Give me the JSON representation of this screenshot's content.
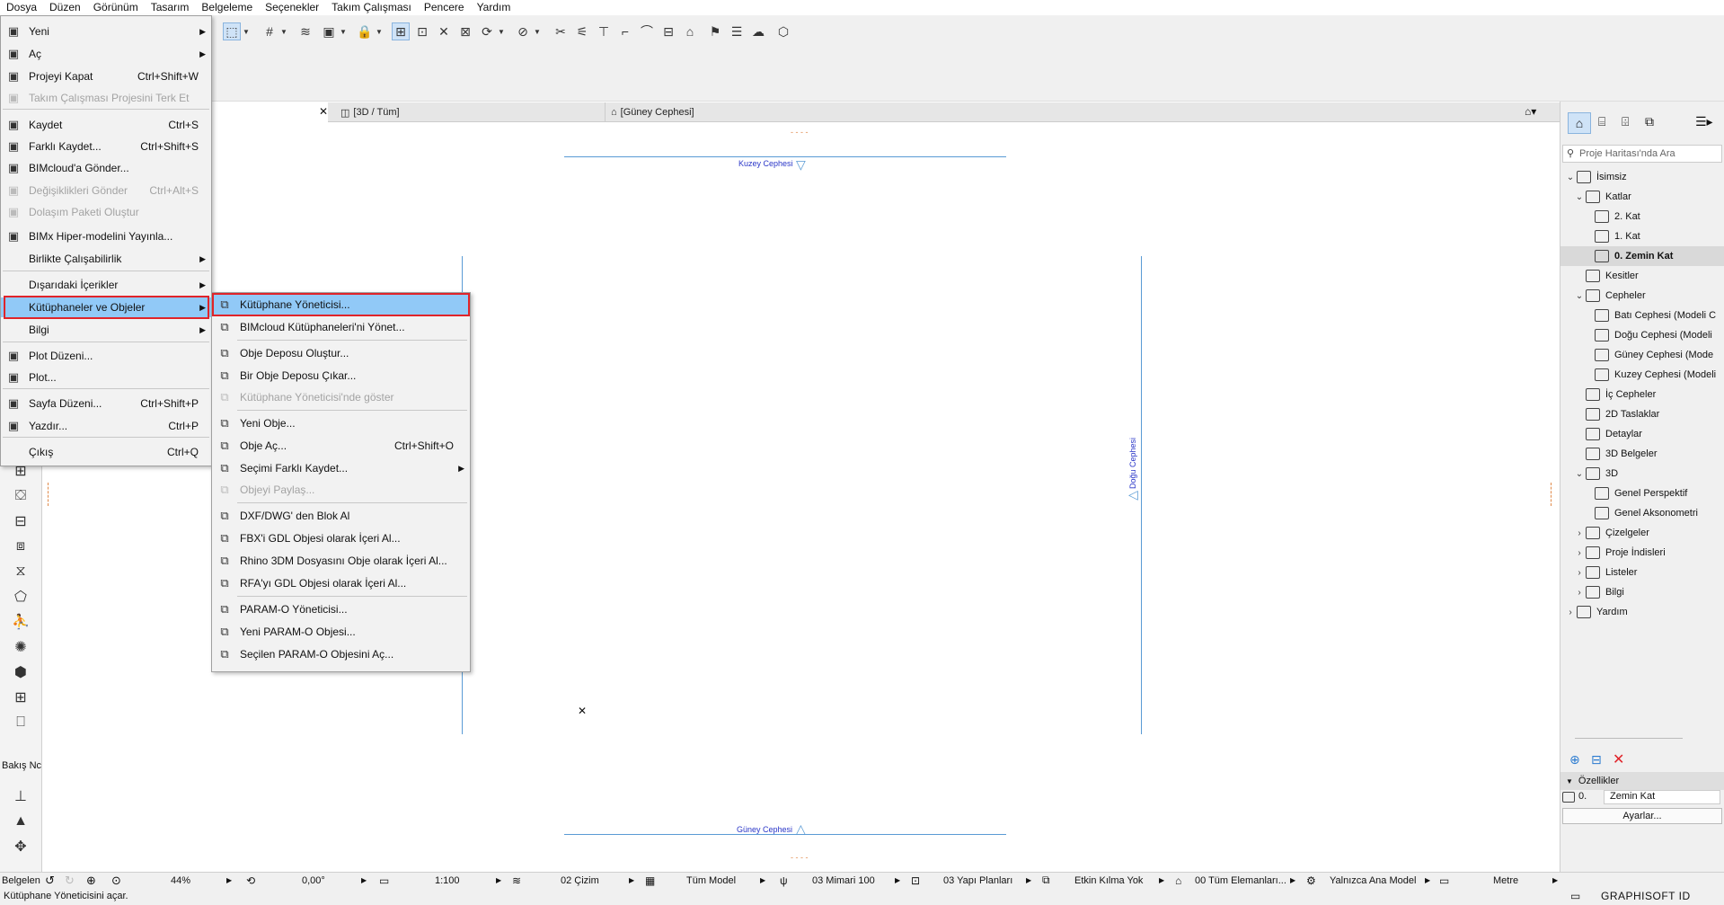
{
  "menubar": [
    "Dosya",
    "Düzen",
    "Görünüm",
    "Tasarım",
    "Belgeleme",
    "Seçenekler",
    "Takım Çalışması",
    "Pencere",
    "Yardım"
  ],
  "tabs": [
    {
      "label": "[3D / Tüm]"
    },
    {
      "label": "[Güney Cephesi]"
    }
  ],
  "canvas": {
    "labels": {
      "north": "Kuzey Cephesi",
      "east": "Doğu Cephesi",
      "south": "Güney Cephesi"
    },
    "dash_marks": "- - - -"
  },
  "file_menu": [
    {
      "label": "Yeni",
      "shortcut": "",
      "submenu": true,
      "disabled": false,
      "icon": "new-file-icon"
    },
    {
      "label": "Aç",
      "shortcut": "",
      "submenu": true,
      "disabled": false,
      "icon": "open-folder-icon"
    },
    {
      "label": "Projeyi Kapat",
      "shortcut": "Ctrl+Shift+W",
      "submenu": false,
      "disabled": false,
      "icon": "close-project-icon"
    },
    {
      "label": "Takım Çalışması Projesini Terk Et",
      "shortcut": "",
      "submenu": false,
      "disabled": true,
      "icon": "team-leave-icon"
    },
    {
      "label": "Kaydet",
      "shortcut": "Ctrl+S",
      "submenu": false,
      "disabled": false,
      "icon": "save-icon"
    },
    {
      "label": "Farklı Kaydet...",
      "shortcut": "Ctrl+Shift+S",
      "submenu": false,
      "disabled": false,
      "icon": "save-as-icon"
    },
    {
      "label": "BIMcloud'a Gönder...",
      "shortcut": "",
      "submenu": false,
      "disabled": false,
      "icon": "cloud-send-icon"
    },
    {
      "label": "Değişiklikleri Gönder",
      "shortcut": "Ctrl+Alt+S",
      "submenu": false,
      "disabled": true,
      "icon": "send-changes-icon"
    },
    {
      "label": "Dolaşım Paketi Oluştur",
      "shortcut": "",
      "submenu": false,
      "disabled": true,
      "icon": "package-icon"
    },
    {
      "label": "BIMx Hiper-modelini Yayınla...",
      "shortcut": "",
      "submenu": false,
      "disabled": false,
      "icon": "bimx-publish-icon"
    },
    {
      "label": "Birlikte Çalışabilirlik",
      "shortcut": "",
      "submenu": true,
      "disabled": false,
      "icon": ""
    },
    {
      "label": "Dışarıdaki İçerikler",
      "shortcut": "",
      "submenu": true,
      "disabled": false,
      "icon": ""
    },
    {
      "label": "Kütüphaneler ve Objeler",
      "shortcut": "",
      "submenu": true,
      "disabled": false,
      "icon": "",
      "highlighted": true
    },
    {
      "label": "Bilgi",
      "shortcut": "",
      "submenu": true,
      "disabled": false,
      "icon": ""
    },
    {
      "label": "Plot Düzeni...",
      "shortcut": "",
      "submenu": false,
      "disabled": false,
      "icon": "plot-setup-icon"
    },
    {
      "label": "Plot...",
      "shortcut": "",
      "submenu": false,
      "disabled": false,
      "icon": "plot-icon"
    },
    {
      "label": "Sayfa Düzeni...",
      "shortcut": "Ctrl+Shift+P",
      "submenu": false,
      "disabled": false,
      "icon": "page-setup-icon"
    },
    {
      "label": "Yazdır...",
      "shortcut": "Ctrl+P",
      "submenu": false,
      "disabled": false,
      "icon": "print-icon"
    },
    {
      "label": "Çıkış",
      "shortcut": "Ctrl+Q",
      "submenu": false,
      "disabled": false,
      "icon": ""
    }
  ],
  "lib_menu": [
    {
      "label": "Kütüphane Yöneticisi...",
      "shortcut": "",
      "submenu": false,
      "disabled": false,
      "icon": "library-manager-icon",
      "highlighted": true
    },
    {
      "label": "BIMcloud Kütüphaneleri'ni Yönet...",
      "shortcut": "",
      "submenu": false,
      "disabled": false,
      "icon": "bimcloud-library-icon"
    },
    {
      "label": "Obje Deposu Oluştur...",
      "shortcut": "",
      "submenu": false,
      "disabled": false,
      "icon": "create-container-icon"
    },
    {
      "label": "Bir Obje Deposu Çıkar...",
      "shortcut": "",
      "submenu": false,
      "disabled": false,
      "icon": "extract-container-icon"
    },
    {
      "label": "Kütüphane Yöneticisi'nde göster",
      "shortcut": "",
      "submenu": false,
      "disabled": true,
      "icon": "show-in-library-icon"
    },
    {
      "label": "Yeni Obje...",
      "shortcut": "",
      "submenu": false,
      "disabled": false,
      "icon": "new-object-icon"
    },
    {
      "label": "Obje Aç...",
      "shortcut": "Ctrl+Shift+O",
      "submenu": false,
      "disabled": false,
      "icon": "open-object-icon"
    },
    {
      "label": "Seçimi Farklı Kaydet...",
      "shortcut": "",
      "submenu": true,
      "disabled": false,
      "icon": "save-selection-icon"
    },
    {
      "label": "Objeyi Paylaş...",
      "shortcut": "",
      "submenu": false,
      "disabled": true,
      "icon": "share-object-icon"
    },
    {
      "label": "DXF/DWG' den Blok Al",
      "shortcut": "",
      "submenu": false,
      "disabled": false,
      "icon": "dxf-import-icon"
    },
    {
      "label": "FBX'i GDL Objesi olarak İçeri Al...",
      "shortcut": "",
      "submenu": false,
      "disabled": false,
      "icon": "fbx-import-icon"
    },
    {
      "label": "Rhino 3DM Dosyasını Obje olarak İçeri Al...",
      "shortcut": "",
      "submenu": false,
      "disabled": false,
      "icon": "rhino-import-icon"
    },
    {
      "label": "RFA'yı GDL Objesi olarak İçeri Al...",
      "shortcut": "",
      "submenu": false,
      "disabled": false,
      "icon": "rfa-import-icon"
    },
    {
      "label": "PARAM-O Yöneticisi...",
      "shortcut": "",
      "submenu": false,
      "disabled": false,
      "icon": "param-o-manager-icon"
    },
    {
      "label": "Yeni PARAM-O Objesi...",
      "shortcut": "",
      "submenu": false,
      "disabled": false,
      "icon": "new-param-o-icon"
    },
    {
      "label": "Seçilen PARAM-O Objesini Aç...",
      "shortcut": "",
      "submenu": false,
      "disabled": false,
      "icon": "open-param-o-icon"
    }
  ],
  "navigator": {
    "search_placeholder": "Proje Haritası'nda Ara",
    "items": [
      {
        "label": "İsimsiz",
        "level": 0,
        "chev": "v"
      },
      {
        "label": "Katlar",
        "level": 1,
        "chev": "v"
      },
      {
        "label": "2. Kat",
        "level": 2,
        "chev": ""
      },
      {
        "label": "1. Kat",
        "level": 2,
        "chev": ""
      },
      {
        "label": "0. Zemin Kat",
        "level": 2,
        "chev": "",
        "selected": true
      },
      {
        "label": "Kesitler",
        "level": 1,
        "chev": ""
      },
      {
        "label": "Cepheler",
        "level": 1,
        "chev": "v"
      },
      {
        "label": "Batı Cephesi (Modeli C",
        "level": 2,
        "chev": ""
      },
      {
        "label": "Doğu Cephesi (Modeli",
        "level": 2,
        "chev": ""
      },
      {
        "label": "Güney Cephesi (Mode",
        "level": 2,
        "chev": ""
      },
      {
        "label": "Kuzey Cephesi (Modeli",
        "level": 2,
        "chev": ""
      },
      {
        "label": "İç Cepheler",
        "level": 1,
        "chev": ""
      },
      {
        "label": "2D Taslaklar",
        "level": 1,
        "chev": ""
      },
      {
        "label": "Detaylar",
        "level": 1,
        "chev": ""
      },
      {
        "label": "3D Belgeler",
        "level": 1,
        "chev": ""
      },
      {
        "label": "3D",
        "level": 1,
        "chev": "v"
      },
      {
        "label": "Genel Perspektif",
        "level": 2,
        "chev": ""
      },
      {
        "label": "Genel Aksonometri",
        "level": 2,
        "chev": ""
      },
      {
        "label": "Çizelgeler",
        "level": 1,
        "chev": ">"
      },
      {
        "label": "Proje İndisleri",
        "level": 1,
        "chev": ">"
      },
      {
        "label": "Listeler",
        "level": 1,
        "chev": ">"
      },
      {
        "label": "Bilgi",
        "level": 1,
        "chev": ">"
      },
      {
        "label": "Yardım",
        "level": 0,
        "chev": ">"
      }
    ],
    "properties_title": "Özellikler",
    "property_id": "0.",
    "property_value": "Zemin Kat",
    "settings_button": "Ayarlar..."
  },
  "bottombar": {
    "left_label": "Belgelen",
    "zoom": "44%",
    "angle": "0,00°",
    "scale": "1:100",
    "layer_combo": "02 Çizim",
    "model_view": "Tüm Model",
    "pen_set": "03 Mimari 100",
    "mvo": "03 Yapı Planları",
    "renovation": "Etkin Kılma Yok",
    "structure": "00 Tüm Elemanları...",
    "display": "Yalnızca Ana Model",
    "units": "Metre"
  },
  "toolbox_label": "Bakış Nc",
  "status_text": "Kütüphane Yöneticisini açar.",
  "brand": "GRAPHISOFT ID",
  "colors": {
    "highlight": "#91c9f7",
    "red_box": "#e0242a",
    "elevation_line": "#5a9bd5",
    "label_blue": "#2a36c8"
  }
}
